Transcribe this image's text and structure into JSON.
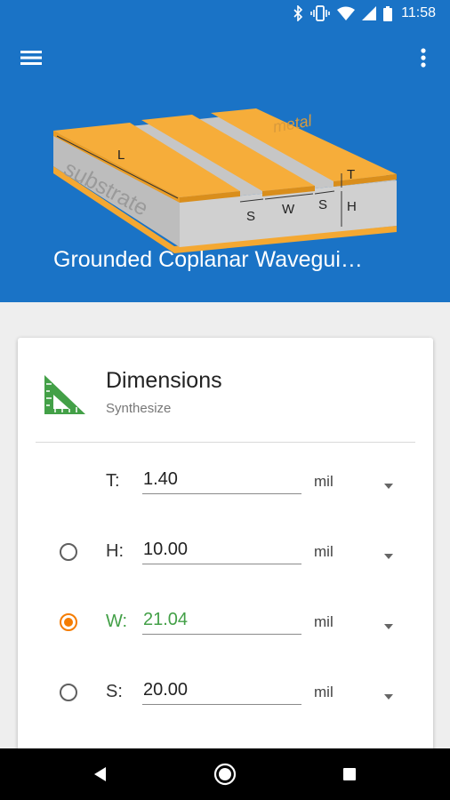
{
  "status_bar": {
    "time": "11:58",
    "icons": [
      "bluetooth-icon",
      "vibrate-icon",
      "wifi-icon",
      "signal-icon",
      "battery-icon"
    ]
  },
  "app_bar": {
    "title": "Grounded Coplanar Wavegui…",
    "menu_icon": "menu-icon",
    "overflow_icon": "more-vert-icon",
    "background": "#1a73c6"
  },
  "illustration": {
    "labels": {
      "L": "L",
      "T": "T",
      "H": "H",
      "S1": "S",
      "W": "W",
      "S2": "S",
      "substrate": "substrate",
      "metal": "metal"
    }
  },
  "card": {
    "title": "Dimensions",
    "subtitle": "Synthesize",
    "icon": "set-square-icon",
    "rows": [
      {
        "label": "T:",
        "value": "1.40",
        "unit": "mil",
        "has_radio": false,
        "selected": false
      },
      {
        "label": "H:",
        "value": "10.00",
        "unit": "mil",
        "has_radio": true,
        "selected": false
      },
      {
        "label": "W:",
        "value": "21.04",
        "unit": "mil",
        "has_radio": true,
        "selected": true
      },
      {
        "label": "S:",
        "value": "20.00",
        "unit": "mil",
        "has_radio": true,
        "selected": false
      }
    ]
  },
  "colors": {
    "accent": "#f57c00",
    "active_text": "#43a047",
    "metal": "#f4a832",
    "substrate": "#cfcfcf"
  },
  "nav_bar": {
    "buttons": [
      "back-icon",
      "home-icon",
      "recents-icon"
    ]
  }
}
